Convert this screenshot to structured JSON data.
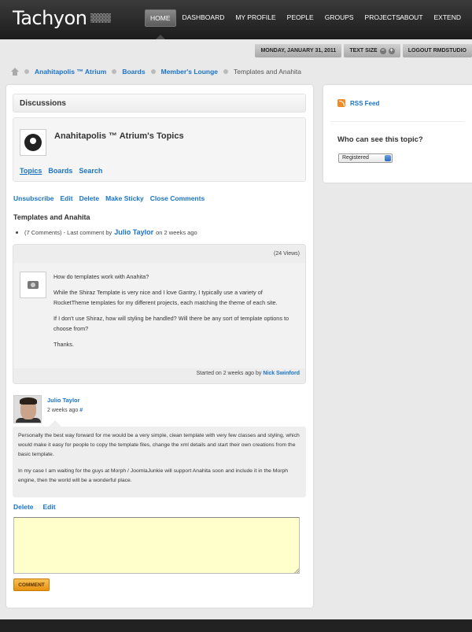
{
  "header": {
    "logo": "Tachyon",
    "nav": [
      "HOME",
      "DASHBOARD",
      "MY PROFILE",
      "PEOPLE",
      "GROUPS",
      "PROJECTS"
    ],
    "nav_right": [
      "ABOUT",
      "EXTEND"
    ]
  },
  "subbar": {
    "date": "MONDAY, JANUARY 31, 2011",
    "text_size": "TEXT SIZE",
    "minus": "−",
    "plus": "+",
    "logout": "LOGOUT RMDSTUDIO"
  },
  "breadcrumb": [
    "Anahitapolis ™ Atrium",
    "Boards",
    "Member's Lounge",
    "Templates and Anahita"
  ],
  "discussions": {
    "title": "Discussions",
    "topics_title": "Anahitapolis ™ Atrium's Topics",
    "tabs": [
      "Topics",
      "Boards",
      "Search"
    ]
  },
  "actions": [
    "Unsubscribe",
    "Edit",
    "Delete",
    "Make Sticky",
    "Close Comments"
  ],
  "topic": {
    "heading": "Templates and Anahita",
    "meta_prefix": "(7 Comments) - Last comment by",
    "meta_author": "Julio Taylor",
    "meta_suffix": "on 2 weeks ago",
    "views": "(24 Views)",
    "paragraphs": [
      "How do templates work with Anahita?",
      "While the Shiraz Template is very nice and I love Gantry, I typically use a variety of RocketTheme templates for my different projects, each matching the theme of each site.",
      "If I don't use Shiraz, how will styling be handled?  Will there be any sort of template options to choose from?",
      "Thanks."
    ],
    "started_prefix": "Started on 2 weeks ago by",
    "started_author": "Nick Swinford"
  },
  "comment": {
    "author": "Julio Taylor",
    "time": "2 weeks ago",
    "hash": "#",
    "paragraphs": [
      "Personally the best way forward for me would be a very simple, clean template with very few classes and styling, which would make it easy for people to copy the template files, change the xml details and start their own creations from the basic template.",
      "In my case I am waiting for the guys at Morph / JoomlaJunkie will support Anahita soon and include it in the Morph engine, then the world will be a wonderful place."
    ],
    "actions": [
      "Delete",
      "Edit"
    ]
  },
  "form": {
    "comment_value": "",
    "submit": "COMMENT"
  },
  "side": {
    "rss": "RSS Feed",
    "who_title": "Who can see this topic?",
    "select_value": "Registered"
  }
}
